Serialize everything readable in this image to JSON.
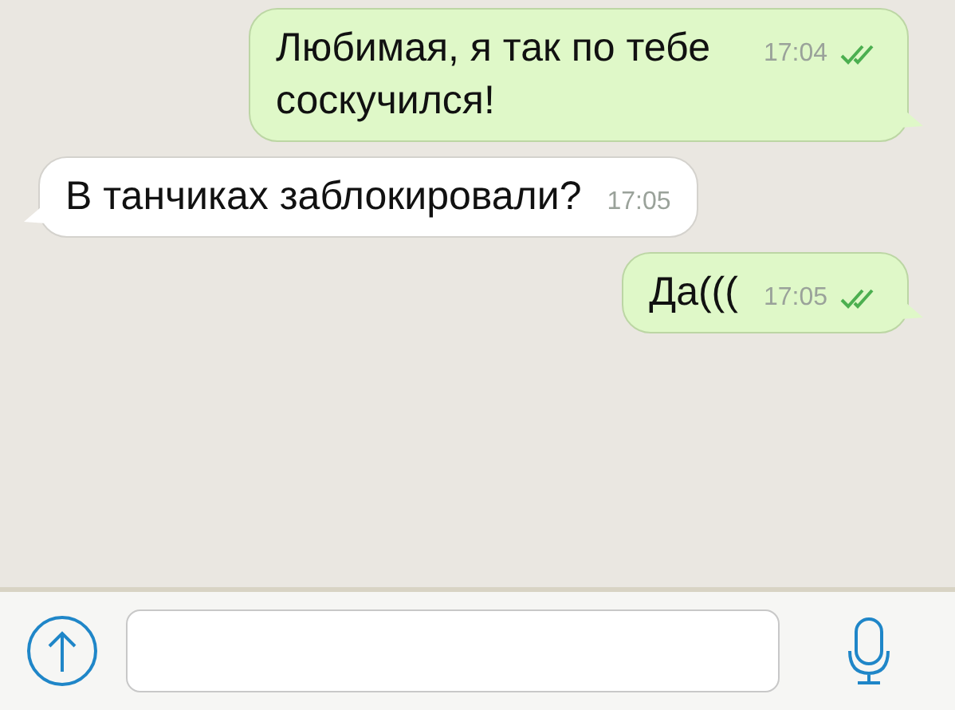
{
  "messages": [
    {
      "kind": "outgoing",
      "text": "Любимая, я так по тебе соскучился!",
      "time": "17:04",
      "read": true
    },
    {
      "kind": "incoming",
      "text": "В танчиках заблокировали?",
      "time": "17:05"
    },
    {
      "kind": "outgoing",
      "text": "Да(((",
      "time": "17:05",
      "read": true
    }
  ]
}
